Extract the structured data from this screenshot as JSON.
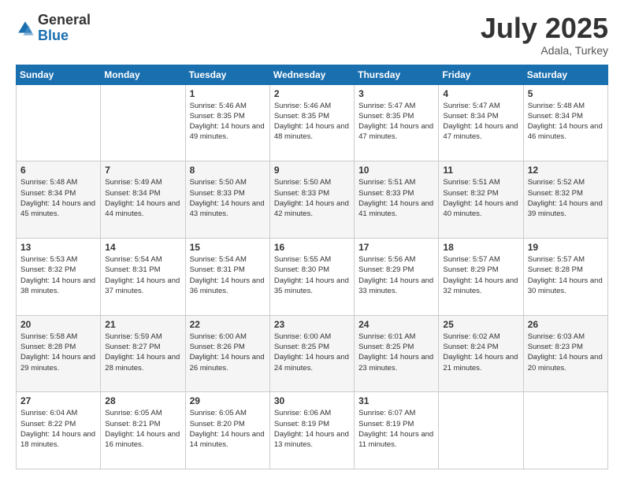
{
  "logo": {
    "general": "General",
    "blue": "Blue"
  },
  "title": "July 2025",
  "location": "Adala, Turkey",
  "days_of_week": [
    "Sunday",
    "Monday",
    "Tuesday",
    "Wednesday",
    "Thursday",
    "Friday",
    "Saturday"
  ],
  "weeks": [
    [
      {
        "day": "",
        "info": ""
      },
      {
        "day": "",
        "info": ""
      },
      {
        "day": "1",
        "info": "Sunrise: 5:46 AM\nSunset: 8:35 PM\nDaylight: 14 hours and 49 minutes."
      },
      {
        "day": "2",
        "info": "Sunrise: 5:46 AM\nSunset: 8:35 PM\nDaylight: 14 hours and 48 minutes."
      },
      {
        "day": "3",
        "info": "Sunrise: 5:47 AM\nSunset: 8:35 PM\nDaylight: 14 hours and 47 minutes."
      },
      {
        "day": "4",
        "info": "Sunrise: 5:47 AM\nSunset: 8:34 PM\nDaylight: 14 hours and 47 minutes."
      },
      {
        "day": "5",
        "info": "Sunrise: 5:48 AM\nSunset: 8:34 PM\nDaylight: 14 hours and 46 minutes."
      }
    ],
    [
      {
        "day": "6",
        "info": "Sunrise: 5:48 AM\nSunset: 8:34 PM\nDaylight: 14 hours and 45 minutes."
      },
      {
        "day": "7",
        "info": "Sunrise: 5:49 AM\nSunset: 8:34 PM\nDaylight: 14 hours and 44 minutes."
      },
      {
        "day": "8",
        "info": "Sunrise: 5:50 AM\nSunset: 8:33 PM\nDaylight: 14 hours and 43 minutes."
      },
      {
        "day": "9",
        "info": "Sunrise: 5:50 AM\nSunset: 8:33 PM\nDaylight: 14 hours and 42 minutes."
      },
      {
        "day": "10",
        "info": "Sunrise: 5:51 AM\nSunset: 8:33 PM\nDaylight: 14 hours and 41 minutes."
      },
      {
        "day": "11",
        "info": "Sunrise: 5:51 AM\nSunset: 8:32 PM\nDaylight: 14 hours and 40 minutes."
      },
      {
        "day": "12",
        "info": "Sunrise: 5:52 AM\nSunset: 8:32 PM\nDaylight: 14 hours and 39 minutes."
      }
    ],
    [
      {
        "day": "13",
        "info": "Sunrise: 5:53 AM\nSunset: 8:32 PM\nDaylight: 14 hours and 38 minutes."
      },
      {
        "day": "14",
        "info": "Sunrise: 5:54 AM\nSunset: 8:31 PM\nDaylight: 14 hours and 37 minutes."
      },
      {
        "day": "15",
        "info": "Sunrise: 5:54 AM\nSunset: 8:31 PM\nDaylight: 14 hours and 36 minutes."
      },
      {
        "day": "16",
        "info": "Sunrise: 5:55 AM\nSunset: 8:30 PM\nDaylight: 14 hours and 35 minutes."
      },
      {
        "day": "17",
        "info": "Sunrise: 5:56 AM\nSunset: 8:29 PM\nDaylight: 14 hours and 33 minutes."
      },
      {
        "day": "18",
        "info": "Sunrise: 5:57 AM\nSunset: 8:29 PM\nDaylight: 14 hours and 32 minutes."
      },
      {
        "day": "19",
        "info": "Sunrise: 5:57 AM\nSunset: 8:28 PM\nDaylight: 14 hours and 30 minutes."
      }
    ],
    [
      {
        "day": "20",
        "info": "Sunrise: 5:58 AM\nSunset: 8:28 PM\nDaylight: 14 hours and 29 minutes."
      },
      {
        "day": "21",
        "info": "Sunrise: 5:59 AM\nSunset: 8:27 PM\nDaylight: 14 hours and 28 minutes."
      },
      {
        "day": "22",
        "info": "Sunrise: 6:00 AM\nSunset: 8:26 PM\nDaylight: 14 hours and 26 minutes."
      },
      {
        "day": "23",
        "info": "Sunrise: 6:00 AM\nSunset: 8:25 PM\nDaylight: 14 hours and 24 minutes."
      },
      {
        "day": "24",
        "info": "Sunrise: 6:01 AM\nSunset: 8:25 PM\nDaylight: 14 hours and 23 minutes."
      },
      {
        "day": "25",
        "info": "Sunrise: 6:02 AM\nSunset: 8:24 PM\nDaylight: 14 hours and 21 minutes."
      },
      {
        "day": "26",
        "info": "Sunrise: 6:03 AM\nSunset: 8:23 PM\nDaylight: 14 hours and 20 minutes."
      }
    ],
    [
      {
        "day": "27",
        "info": "Sunrise: 6:04 AM\nSunset: 8:22 PM\nDaylight: 14 hours and 18 minutes."
      },
      {
        "day": "28",
        "info": "Sunrise: 6:05 AM\nSunset: 8:21 PM\nDaylight: 14 hours and 16 minutes."
      },
      {
        "day": "29",
        "info": "Sunrise: 6:05 AM\nSunset: 8:20 PM\nDaylight: 14 hours and 14 minutes."
      },
      {
        "day": "30",
        "info": "Sunrise: 6:06 AM\nSunset: 8:19 PM\nDaylight: 14 hours and 13 minutes."
      },
      {
        "day": "31",
        "info": "Sunrise: 6:07 AM\nSunset: 8:19 PM\nDaylight: 14 hours and 11 minutes."
      },
      {
        "day": "",
        "info": ""
      },
      {
        "day": "",
        "info": ""
      }
    ]
  ]
}
